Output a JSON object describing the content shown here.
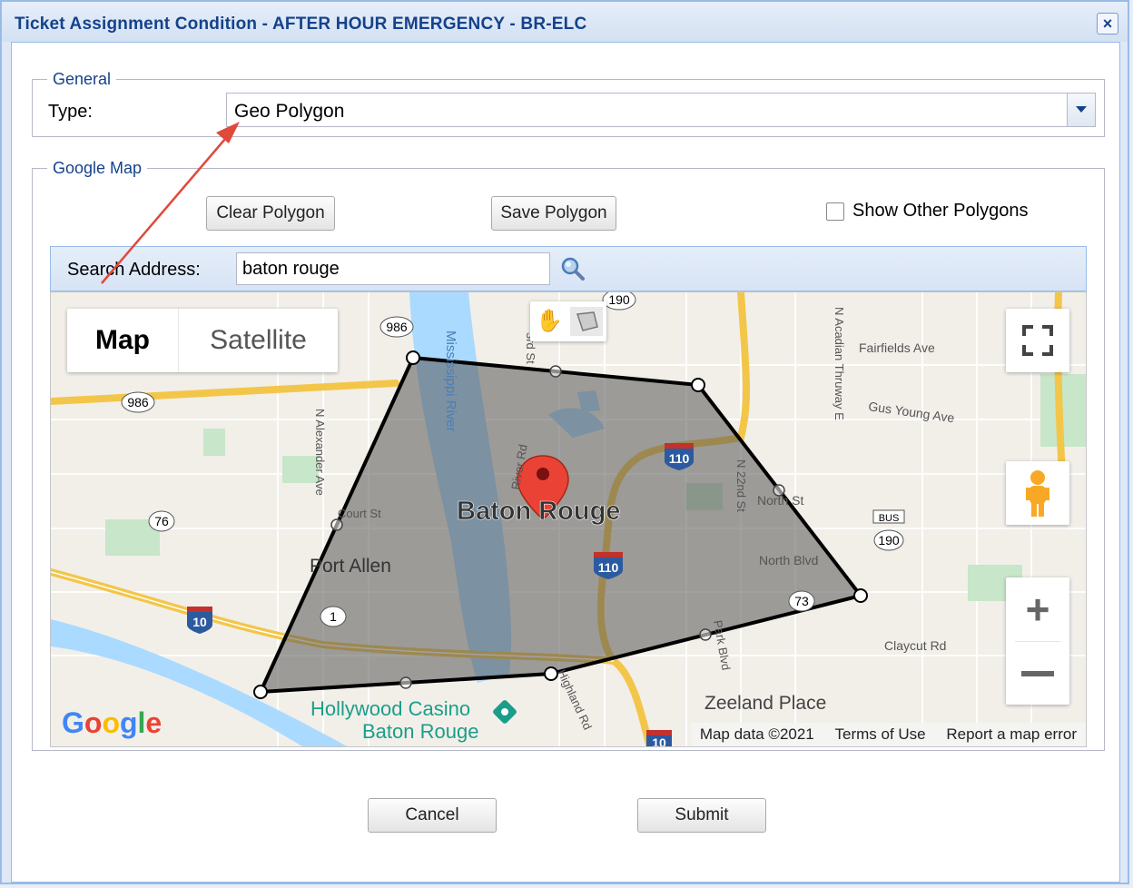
{
  "dialog": {
    "title": "Ticket Assignment Condition - AFTER HOUR EMERGENCY - BR-ELC",
    "close_icon": "×"
  },
  "general": {
    "legend": "General",
    "type_label": "Type:",
    "type_value": "Geo Polygon"
  },
  "google_map": {
    "legend": "Google Map",
    "clear_polygon": "Clear Polygon",
    "save_polygon": "Save Polygon",
    "show_other_polygons": "Show Other Polygons",
    "search_label": "Search Address:",
    "search_value": "baton rouge",
    "map_type_map": "Map",
    "map_type_satellite": "Satellite",
    "map_labels": {
      "city": "Baton Rouge",
      "port_allen": "Port Allen",
      "mississippi": "Mississippi River",
      "hollywood_casino_1": "Hollywood Casino",
      "hollywood_casino_2": "Baton Rouge",
      "zeeland": "Zeeland Place",
      "fairfields": "Fairfields Ave",
      "gus_young": "Gus Young Ave",
      "north_blvd": "North Blvd",
      "north_st": "North St",
      "claycut": "Claycut Rd",
      "court_st": "Court St",
      "n_alexander": "N Alexander Ave",
      "river_rd": "River Rd",
      "third_st": "3rd St",
      "n_22nd": "N 22nd St",
      "n_acadian": "N Acadian Thruway E",
      "park_blvd": "Park Blvd",
      "highland": "Highland Rd",
      "shield_986a": "986",
      "shield_986b": "986",
      "shield_190a": "190",
      "shield_190b": "190",
      "shield_76": "76",
      "shield_1": "1",
      "shield_73": "73",
      "shield_110a": "110",
      "shield_110b": "110",
      "shield_10a": "10",
      "shield_10b": "10",
      "bus": "BUS"
    },
    "google_logo": "Google",
    "attribution": {
      "map_data": "Map data ©2021",
      "terms": "Terms of Use",
      "report": "Report a map error"
    }
  },
  "footer": {
    "cancel": "Cancel",
    "submit": "Submit"
  },
  "colors": {
    "title": "#15428b",
    "border": "#99bbe8",
    "polygon_fill": "#555555",
    "river": "#aadaff",
    "interstate": "#f3c64a",
    "marker": "#ea4335"
  }
}
